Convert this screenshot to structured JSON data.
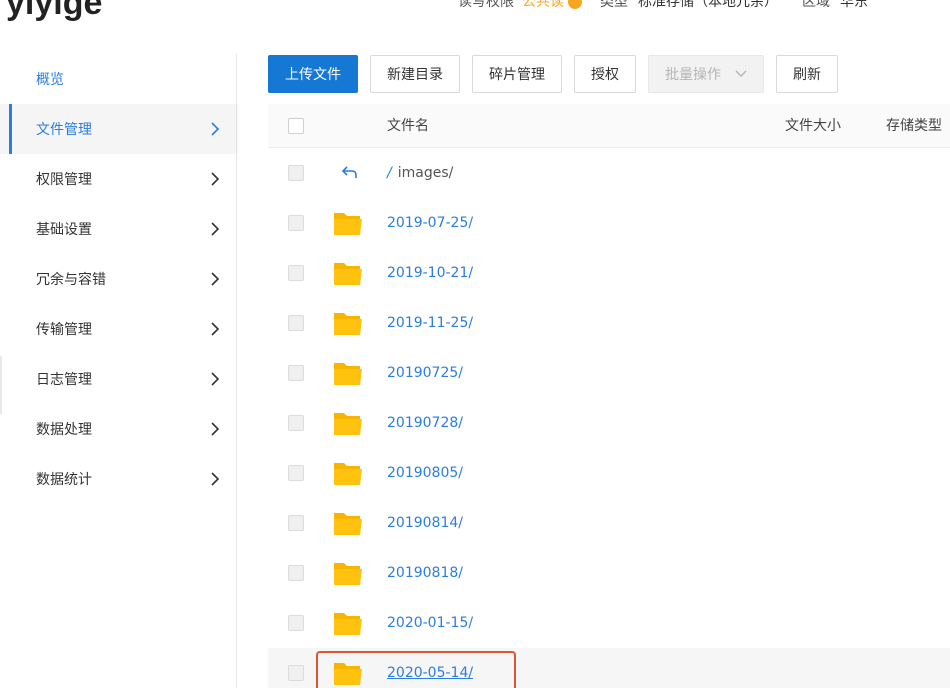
{
  "header": {
    "brand": "yiyige",
    "access_label": "读写权限",
    "access_value": "公共读",
    "type_label": "类型",
    "type_value": "标准存储（本地冗余）",
    "region_label": "区域",
    "region_value": "华东"
  },
  "sidebar": {
    "items": [
      {
        "label": "概览"
      },
      {
        "label": "文件管理"
      },
      {
        "label": "权限管理"
      },
      {
        "label": "基础设置"
      },
      {
        "label": "冗余与容错"
      },
      {
        "label": "传输管理"
      },
      {
        "label": "日志管理"
      },
      {
        "label": "数据处理"
      },
      {
        "label": "数据统计"
      }
    ]
  },
  "toolbar": {
    "upload_label": "上传文件",
    "new_dir_label": "新建目录",
    "fragments_label": "碎片管理",
    "authorize_label": "授权",
    "batch_label": "批量操作",
    "refresh_label": "刷新"
  },
  "table": {
    "columns": {
      "name": "文件名",
      "size": "文件大小",
      "storage_type": "存储类型"
    },
    "path": {
      "slash": "/",
      "text": "images/"
    },
    "rows": [
      {
        "name": "2019-07-25/"
      },
      {
        "name": "2019-10-21/"
      },
      {
        "name": "2019-11-25/"
      },
      {
        "name": "20190725/"
      },
      {
        "name": "20190728/"
      },
      {
        "name": "20190805/"
      },
      {
        "name": "20190814/"
      },
      {
        "name": "20190818/"
      },
      {
        "name": "2020-01-15/"
      },
      {
        "name": "2020-05-14/"
      }
    ]
  },
  "colors": {
    "accent": "#2b7de0",
    "primary_button": "#1478d4",
    "folder": "#ffc20e",
    "highlight": "#e0542f"
  }
}
